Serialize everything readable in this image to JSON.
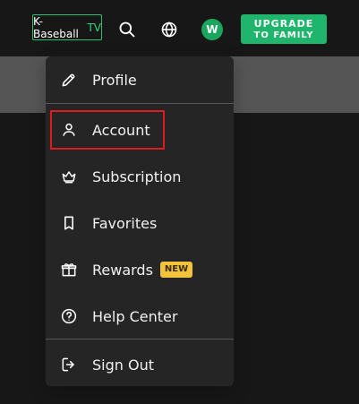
{
  "header": {
    "logo": {
      "part1": "K-Baseball",
      "part2": "TV"
    },
    "avatar_initial": "W",
    "upgrade": {
      "line1": "UPGRADE",
      "line2": "TO FAMILY"
    },
    "icons": {
      "search": "search-icon",
      "language": "globe-icon"
    },
    "colors": {
      "brand_green": "#20b56d",
      "avatar_green": "#1ba65f",
      "badge_yellow": "#f3c33b",
      "highlight_red": "#e01b1b"
    }
  },
  "menu": {
    "items": [
      {
        "label": "Profile",
        "icon": "pencil-icon"
      },
      {
        "label": "Account",
        "icon": "user-icon"
      },
      {
        "label": "Subscription",
        "icon": "crown-icon"
      },
      {
        "label": "Favorites",
        "icon": "bookmark-icon"
      },
      {
        "label": "Rewards",
        "icon": "gift-icon",
        "badge": "NEW"
      },
      {
        "label": "Help Center",
        "icon": "help-icon"
      },
      {
        "label": "Sign Out",
        "icon": "sign-out-icon"
      }
    ]
  }
}
